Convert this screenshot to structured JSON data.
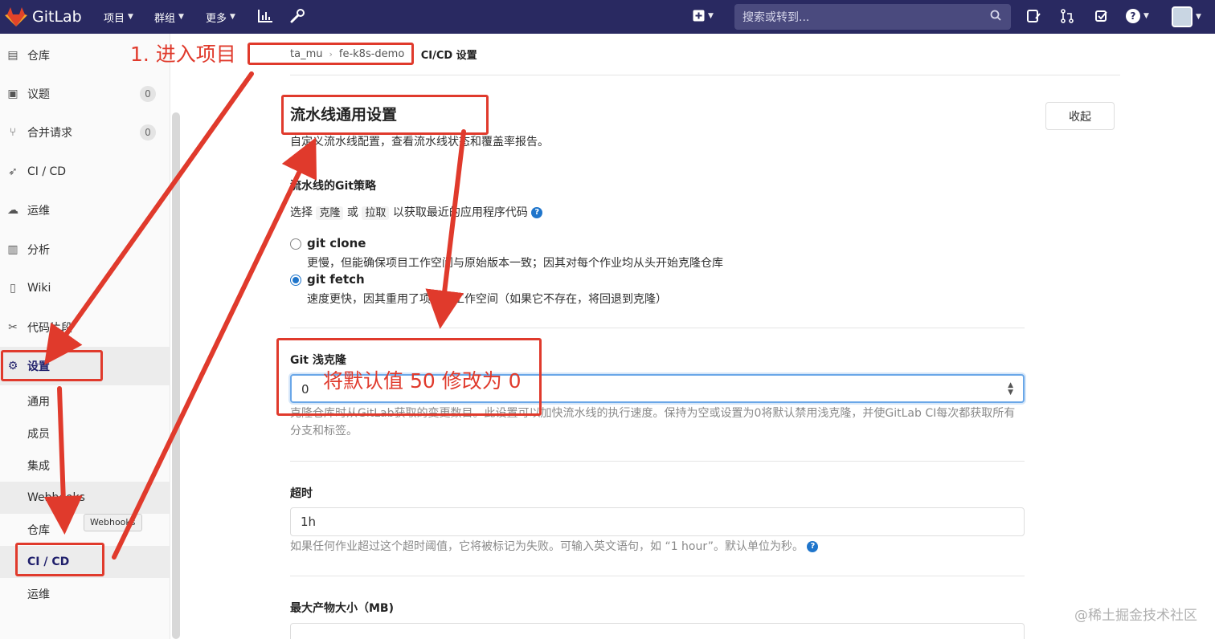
{
  "topbar": {
    "brand": "GitLab",
    "nav": [
      {
        "label": "项目"
      },
      {
        "label": "群组"
      },
      {
        "label": "更多"
      }
    ],
    "search_placeholder": "搜索或转到..."
  },
  "sidebar": {
    "items": [
      {
        "label": "仓库",
        "icon": "document-icon"
      },
      {
        "label": "议题",
        "icon": "issues-icon",
        "badge": "0"
      },
      {
        "label": "合并请求",
        "icon": "merge-request-icon",
        "badge": "0"
      },
      {
        "label": "CI / CD",
        "icon": "rocket-icon"
      },
      {
        "label": "运维",
        "icon": "cloud-icon"
      },
      {
        "label": "分析",
        "icon": "chart-icon"
      },
      {
        "label": "Wiki",
        "icon": "book-icon"
      },
      {
        "label": "代码片段",
        "icon": "scissors-icon"
      },
      {
        "label": "设置",
        "icon": "gear-icon"
      }
    ],
    "settings_sub": [
      {
        "label": "通用"
      },
      {
        "label": "成员"
      },
      {
        "label": "集成"
      },
      {
        "label": "Webhooks"
      },
      {
        "label": "仓库"
      },
      {
        "label": "CI / CD"
      },
      {
        "label": "运维"
      }
    ],
    "tooltip": "Webhooks"
  },
  "breadcrumb": [
    "ta_mu",
    "fe-k8s-demo",
    "CI/CD 设置"
  ],
  "section": {
    "title": "流水线通用设置",
    "description": "自定义流水线配置，查看流水线状态和覆盖率报告。",
    "collapse_label": "收起"
  },
  "git_strategy": {
    "label": "流水线的Git策略",
    "help_pre": "选择",
    "help_code1": "克隆",
    "help_mid": "或",
    "help_code2": "拉取",
    "help_post": "以获取最近的应用程序代码",
    "options": [
      {
        "title": "git clone",
        "desc": "更慢，但能确保项目工作空间与原始版本一致；因其对每个作业均从头开始克隆仓库",
        "selected": false
      },
      {
        "title": "git fetch",
        "desc": "速度更快，因其重用了项目的工作空间（如果它不存在，将回退到克隆）",
        "selected": true
      }
    ]
  },
  "shallow_clone": {
    "label": "Git 浅克隆",
    "value": "0",
    "hint": "克隆仓库时从GitLab获取的变更数目。此设置可以加快流水线的执行速度。保持为空或设置为0将默认禁用浅克隆，并使GitLab CI每次都获取所有分支和标签。"
  },
  "timeout": {
    "label": "超时",
    "value": "1h",
    "hint": "如果任何作业超过这个超时阈值，它将被标记为失败。可输入英文语句，如 “1 hour”。默认单位为秒。"
  },
  "artifact_size": {
    "label": "最大产物大小（MB)"
  },
  "annotations": {
    "step1": "1. 进入项目",
    "note": "将默认值 50 修改为 0",
    "color": "#e03a2c"
  },
  "watermark": "@稀土掘金技术社区"
}
